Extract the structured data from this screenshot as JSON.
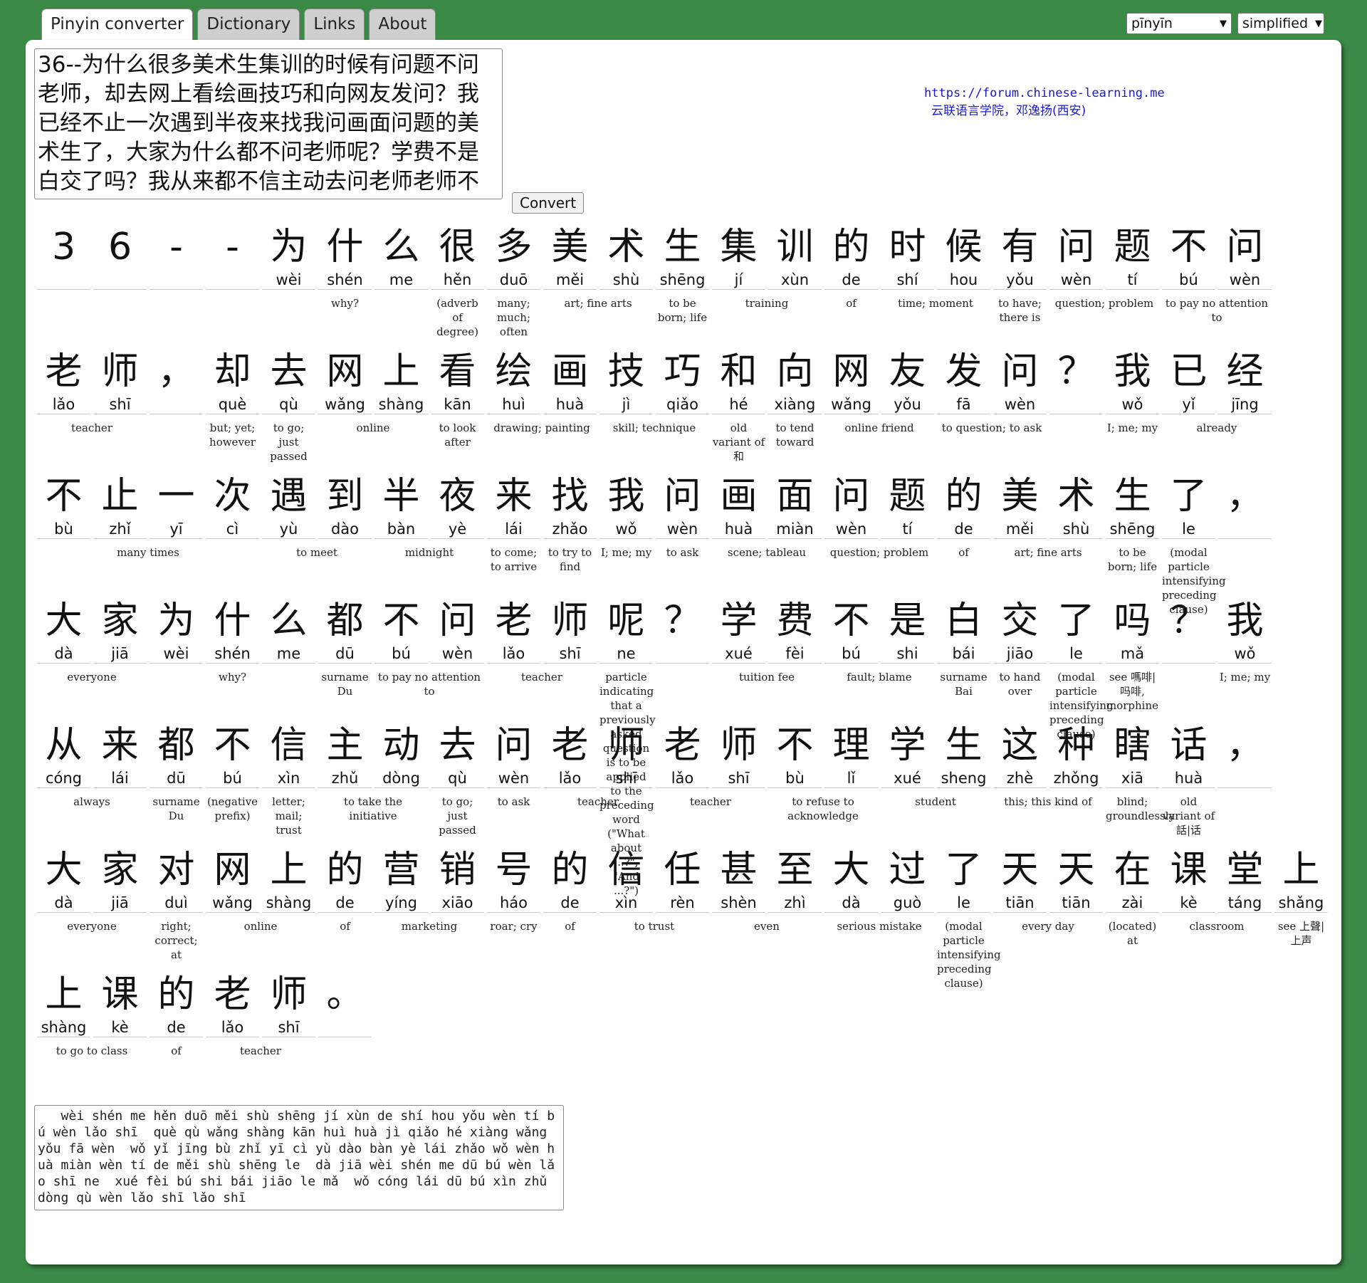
{
  "tabs": [
    "Pinyin converter",
    "Dictionary",
    "Links",
    "About"
  ],
  "selects": {
    "mode": "pīnyīn",
    "script": "simplified"
  },
  "input_text": "36--为什么很多美术生集训的时候有问题不问老师，却去网上看绘画技巧和向网友发问？我已经不止一次遇到半夜来找我问画面问题的美术生了，大家为什么都不问老师呢？学费不是白交了吗？我从来都不信主动去问老师老师不理学生这种瞎话，大家对网上的营销号的信任甚至大过了",
  "convert_label": "Convert",
  "credit": {
    "url": "https://forum.chinese-learning.me",
    "line2": "云联语言学院，邓逸扬(西安)"
  },
  "rows": [
    {
      "chars": [
        [
          "3",
          ""
        ],
        [
          "6",
          ""
        ],
        [
          "-",
          ""
        ],
        [
          "-",
          ""
        ],
        [
          "为",
          "wèi"
        ],
        [
          "什",
          "shén"
        ],
        [
          "么",
          "me"
        ],
        [
          "很",
          "hěn"
        ],
        [
          "多",
          "duō"
        ],
        [
          "美",
          "měi"
        ],
        [
          "术",
          "shù"
        ],
        [
          "生",
          "shēng"
        ],
        [
          "集",
          "jí"
        ],
        [
          "训",
          "xùn"
        ],
        [
          "的",
          "de"
        ],
        [
          "时",
          "shí"
        ],
        [
          "候",
          "hou"
        ],
        [
          "有",
          "yǒu"
        ],
        [
          "问",
          "wèn"
        ],
        [
          "题",
          "tí"
        ],
        [
          "不",
          "bú"
        ],
        [
          "问",
          "wèn"
        ]
      ],
      "defs": [
        [
          4,
          3,
          "why?"
        ],
        [
          7,
          1,
          "(adverb of degree)"
        ],
        [
          8,
          1,
          "many; much; often"
        ],
        [
          9,
          2,
          "art; fine arts"
        ],
        [
          11,
          1,
          "to be born; life"
        ],
        [
          12,
          2,
          "training"
        ],
        [
          14,
          1,
          "of"
        ],
        [
          15,
          2,
          "time; moment"
        ],
        [
          17,
          1,
          "to have; there is"
        ],
        [
          18,
          2,
          "question; problem"
        ],
        [
          20,
          2,
          "to pay no attention to"
        ]
      ]
    },
    {
      "chars": [
        [
          "老",
          "lǎo"
        ],
        [
          "师",
          "shī"
        ],
        [
          "，",
          ""
        ],
        [
          "却",
          "què"
        ],
        [
          "去",
          "qù"
        ],
        [
          "网",
          "wǎng"
        ],
        [
          "上",
          "shàng"
        ],
        [
          "看",
          "kān"
        ],
        [
          "绘",
          "huì"
        ],
        [
          "画",
          "huà"
        ],
        [
          "技",
          "jì"
        ],
        [
          "巧",
          "qiǎo"
        ],
        [
          "和",
          "hé"
        ],
        [
          "向",
          "xiàng"
        ],
        [
          "网",
          "wǎng"
        ],
        [
          "友",
          "yǒu"
        ],
        [
          "发",
          "fā"
        ],
        [
          "问",
          "wèn"
        ],
        [
          "？",
          ""
        ],
        [
          "我",
          "wǒ"
        ],
        [
          "已",
          "yǐ"
        ],
        [
          "经",
          "jīng"
        ]
      ],
      "defs": [
        [
          0,
          2,
          "teacher"
        ],
        [
          3,
          1,
          "but; yet; however"
        ],
        [
          4,
          1,
          "to go; just passed"
        ],
        [
          5,
          2,
          "online"
        ],
        [
          7,
          1,
          "to look after"
        ],
        [
          8,
          2,
          "drawing; painting"
        ],
        [
          10,
          2,
          "skill; technique"
        ],
        [
          12,
          1,
          "old variant of 和"
        ],
        [
          13,
          1,
          "to tend toward"
        ],
        [
          14,
          2,
          "online friend"
        ],
        [
          16,
          2,
          "to question; to ask"
        ],
        [
          19,
          1,
          "I; me; my"
        ],
        [
          20,
          2,
          "already"
        ]
      ]
    },
    {
      "chars": [
        [
          "不",
          "bù"
        ],
        [
          "止",
          "zhǐ"
        ],
        [
          "一",
          "yī"
        ],
        [
          "次",
          "cì"
        ],
        [
          "遇",
          "yù"
        ],
        [
          "到",
          "dào"
        ],
        [
          "半",
          "bàn"
        ],
        [
          "夜",
          "yè"
        ],
        [
          "来",
          "lái"
        ],
        [
          "找",
          "zhǎo"
        ],
        [
          "我",
          "wǒ"
        ],
        [
          "问",
          "wèn"
        ],
        [
          "画",
          "huà"
        ],
        [
          "面",
          "miàn"
        ],
        [
          "问",
          "wèn"
        ],
        [
          "题",
          "tí"
        ],
        [
          "的",
          "de"
        ],
        [
          "美",
          "měi"
        ],
        [
          "术",
          "shù"
        ],
        [
          "生",
          "shēng"
        ],
        [
          "了",
          "le"
        ],
        [
          "，",
          ""
        ]
      ],
      "defs": [
        [
          0,
          4,
          "many times"
        ],
        [
          4,
          2,
          "to meet"
        ],
        [
          6,
          2,
          "midnight"
        ],
        [
          8,
          1,
          "to come; to arrive"
        ],
        [
          9,
          1,
          "to try to find"
        ],
        [
          10,
          1,
          "I; me; my"
        ],
        [
          11,
          1,
          "to ask"
        ],
        [
          12,
          2,
          "scene; tableau"
        ],
        [
          14,
          2,
          "question; problem"
        ],
        [
          16,
          1,
          "of"
        ],
        [
          17,
          2,
          "art; fine arts"
        ],
        [
          19,
          1,
          "to be born; life"
        ],
        [
          20,
          1,
          "(modal particle intensifying preceding clause)"
        ]
      ]
    },
    {
      "chars": [
        [
          "大",
          "dà"
        ],
        [
          "家",
          "jiā"
        ],
        [
          "为",
          "wèi"
        ],
        [
          "什",
          "shén"
        ],
        [
          "么",
          "me"
        ],
        [
          "都",
          "dū"
        ],
        [
          "不",
          "bú"
        ],
        [
          "问",
          "wèn"
        ],
        [
          "老",
          "lǎo"
        ],
        [
          "师",
          "shī"
        ],
        [
          "呢",
          "ne"
        ],
        [
          "？",
          ""
        ],
        [
          "学",
          "xué"
        ],
        [
          "费",
          "fèi"
        ],
        [
          "不",
          "bú"
        ],
        [
          "是",
          "shi"
        ],
        [
          "白",
          "bái"
        ],
        [
          "交",
          "jiāo"
        ],
        [
          "了",
          "le"
        ],
        [
          "吗",
          "mǎ"
        ],
        [
          "？",
          ""
        ],
        [
          "我",
          "wǒ"
        ]
      ],
      "defs": [
        [
          0,
          2,
          "everyone"
        ],
        [
          2,
          3,
          "why?"
        ],
        [
          5,
          1,
          "surname Du"
        ],
        [
          6,
          2,
          "to pay no attention to"
        ],
        [
          8,
          2,
          "teacher"
        ],
        [
          10,
          1,
          "particle indicating that a previously asked question is to be applied to the preceding word (\"What about ...?\", \"And ...?\")"
        ],
        [
          12,
          2,
          "tuition fee"
        ],
        [
          14,
          2,
          "fault; blame"
        ],
        [
          16,
          1,
          "surname Bai"
        ],
        [
          17,
          1,
          "to hand over"
        ],
        [
          18,
          1,
          "(modal particle intensifying preceding clause)"
        ],
        [
          19,
          1,
          "see 嗎啡|吗啡, morphine"
        ],
        [
          21,
          1,
          "I; me; my"
        ]
      ]
    },
    {
      "chars": [
        [
          "从",
          "cóng"
        ],
        [
          "来",
          "lái"
        ],
        [
          "都",
          "dū"
        ],
        [
          "不",
          "bú"
        ],
        [
          "信",
          "xìn"
        ],
        [
          "主",
          "zhǔ"
        ],
        [
          "动",
          "dòng"
        ],
        [
          "去",
          "qù"
        ],
        [
          "问",
          "wèn"
        ],
        [
          "老",
          "lǎo"
        ],
        [
          "师",
          "shī"
        ],
        [
          "老",
          "lǎo"
        ],
        [
          "师",
          "shī"
        ],
        [
          "不",
          "bù"
        ],
        [
          "理",
          "lǐ"
        ],
        [
          "学",
          "xué"
        ],
        [
          "生",
          "sheng"
        ],
        [
          "这",
          "zhè"
        ],
        [
          "种",
          "zhǒng"
        ],
        [
          "瞎",
          "xiā"
        ],
        [
          "话",
          "huà"
        ],
        [
          "，",
          ""
        ]
      ],
      "defs": [
        [
          0,
          2,
          "always"
        ],
        [
          2,
          1,
          "surname Du"
        ],
        [
          3,
          1,
          "(negative prefix)"
        ],
        [
          4,
          1,
          "letter; mail; trust"
        ],
        [
          5,
          2,
          "to take the initiative"
        ],
        [
          7,
          1,
          "to go; just passed"
        ],
        [
          8,
          1,
          "to ask"
        ],
        [
          9,
          2,
          "teacher"
        ],
        [
          11,
          2,
          "teacher"
        ],
        [
          13,
          2,
          "to refuse to acknowledge"
        ],
        [
          15,
          2,
          "student"
        ],
        [
          17,
          2,
          "this; this kind of"
        ],
        [
          19,
          1,
          "blind; groundlessly"
        ],
        [
          20,
          1,
          "old variant of 話|话"
        ]
      ]
    },
    {
      "chars": [
        [
          "大",
          "dà"
        ],
        [
          "家",
          "jiā"
        ],
        [
          "对",
          "duì"
        ],
        [
          "网",
          "wǎng"
        ],
        [
          "上",
          "shàng"
        ],
        [
          "的",
          "de"
        ],
        [
          "营",
          "yíng"
        ],
        [
          "销",
          "xiāo"
        ],
        [
          "号",
          "háo"
        ],
        [
          "的",
          "de"
        ],
        [
          "信",
          "xìn"
        ],
        [
          "任",
          "rèn"
        ],
        [
          "甚",
          "shèn"
        ],
        [
          "至",
          "zhì"
        ],
        [
          "大",
          "dà"
        ],
        [
          "过",
          "guò"
        ],
        [
          "了",
          "le"
        ],
        [
          "天",
          "tiān"
        ],
        [
          "天",
          "tiān"
        ],
        [
          "在",
          "zài"
        ],
        [
          "课",
          "kè"
        ],
        [
          "堂",
          "táng"
        ],
        [
          "上",
          "shǎng"
        ]
      ],
      "defs": [
        [
          0,
          2,
          "everyone"
        ],
        [
          2,
          1,
          "right; correct; at"
        ],
        [
          3,
          2,
          "online"
        ],
        [
          5,
          1,
          "of"
        ],
        [
          6,
          2,
          "marketing"
        ],
        [
          8,
          1,
          "roar; cry"
        ],
        [
          9,
          1,
          "of"
        ],
        [
          10,
          2,
          "to trust"
        ],
        [
          12,
          2,
          "even"
        ],
        [
          14,
          2,
          "serious mistake"
        ],
        [
          16,
          1,
          "(modal particle intensifying preceding clause)"
        ],
        [
          17,
          2,
          "every day"
        ],
        [
          19,
          1,
          "(located) at"
        ],
        [
          20,
          2,
          "classroom"
        ],
        [
          22,
          1,
          "see 上聲|上声"
        ]
      ]
    },
    {
      "chars": [
        [
          "上",
          "shàng"
        ],
        [
          "课",
          "kè"
        ],
        [
          "的",
          "de"
        ],
        [
          "老",
          "lǎo"
        ],
        [
          "师",
          "shī"
        ],
        [
          "。",
          ""
        ]
      ],
      "defs": [
        [
          0,
          2,
          "to go to class"
        ],
        [
          2,
          1,
          "of"
        ],
        [
          3,
          2,
          "teacher"
        ]
      ]
    }
  ],
  "output_text": "   wèi shén me hěn duō měi shù shēng jí xùn de shí hou yǒu wèn tí bú wèn lǎo shī  què qù wǎng shàng kān huì huà jì qiǎo hé xiàng wǎng yǒu fā wèn  wǒ yǐ jīng bù zhǐ yī cì yù dào bàn yè lái zhǎo wǒ wèn huà miàn wèn tí de měi shù shēng le  dà jiā wèi shén me dū bú wèn lǎo shī ne  xué fèi bú shi bái jiāo le mǎ  wǒ cóng lái dū bú xìn zhǔ dòng qù wèn lǎo shī lǎo shī"
}
